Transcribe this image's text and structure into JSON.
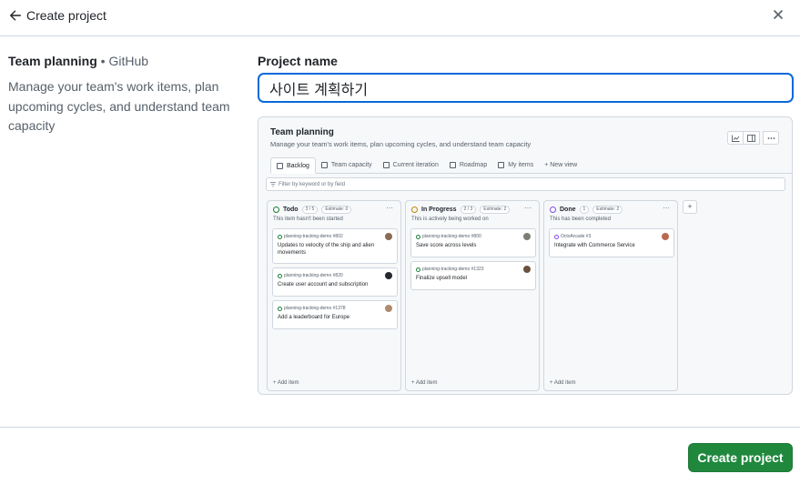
{
  "header": {
    "title": "Create project",
    "back_icon": "arrow-left-icon",
    "close_icon": "x-icon"
  },
  "template": {
    "name": "Team planning",
    "separator": "•",
    "source": "GitHub",
    "description": "Manage your team's work items, plan upcoming cycles, and understand team capacity"
  },
  "project_name": {
    "label": "Project name",
    "value": "사이트 계획하기"
  },
  "preview": {
    "title": "Team planning",
    "description": "Manage your team's work items, plan upcoming cycles, and understand team capacity",
    "tabs": [
      "Backlog",
      "Team capacity",
      "Current iteration",
      "Roadmap",
      "My items",
      "+ New view"
    ],
    "filter_placeholder": "Filter by keyword or by field",
    "columns": [
      {
        "name": "Todo",
        "count": "3 / 5",
        "estimate": "Estimate: 0",
        "color": "#1a7f37",
        "description": "This item hasn't been started",
        "cards": [
          {
            "repo": "planning-tracking-demo #802",
            "title": "Updates to velocity of the ship and alien movements"
          },
          {
            "repo": "planning-tracking-demo #820",
            "title": "Create user account and subscription"
          },
          {
            "repo": "planning-tracking-demo #1378",
            "title": "Add a leaderboard for Europe"
          }
        ],
        "add_label": "+  Add item"
      },
      {
        "name": "In Progress",
        "count": "2 / 3",
        "estimate": "Estimate: 2",
        "color": "#bf8700",
        "description": "This is actively being worked on",
        "cards": [
          {
            "repo": "planning-tracking-demo #800",
            "title": "Save score across levels"
          },
          {
            "repo": "planning-tracking-demo #1323",
            "title": "Finalize upsell model"
          }
        ],
        "add_label": "+  Add item"
      },
      {
        "name": "Done",
        "count": "1",
        "estimate": "Estimate: 2",
        "color": "#8250df",
        "description": "This has been completed",
        "cards": [
          {
            "repo": "OctoArcade #3",
            "title": "Integrate with Commerce Service"
          }
        ],
        "add_label": "+  Add item"
      }
    ],
    "add_column_label": "+"
  },
  "footer": {
    "create_label": "Create project",
    "create_color": "#1f883d"
  }
}
